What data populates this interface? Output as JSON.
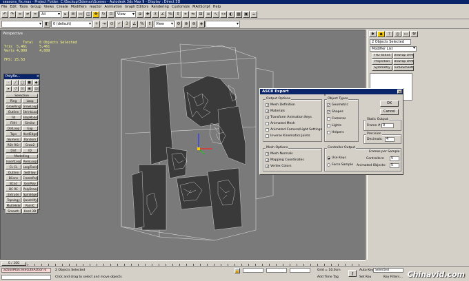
{
  "app": {
    "title": "seasons_fix.max - Project Folder: C:\\Backup\\3dsmax\\Scenes - Autodesk 3ds Max 9 - Display : Direct 3D"
  },
  "menu": [
    "File",
    "Edit",
    "Tools",
    "Group",
    "Views",
    "Create",
    "Modifiers",
    "reactor",
    "Animation",
    "Graph Editors",
    "Rendering",
    "Customize",
    "MAXScript",
    "Help"
  ],
  "toolbar": {
    "filter_select": "All",
    "view_select": "View",
    "layer_select": "0 (default)",
    "view_select_2": "View"
  },
  "viewport": {
    "label": "Perspective",
    "stats": "         Total   0 Objects Selected\nTris  5,461      5,461\nVerts 4,009      4,009",
    "fps": "FPS:  25.53"
  },
  "command_panel": {
    "object_field": "2 Objects Selected",
    "modifier_list": "Modifier List",
    "buttons": [
      "FFD 4x4x4",
      "Unwrap UVW",
      "Projection",
      "Unwrap UVW",
      "Symmetry",
      "TurboSmooth"
    ]
  },
  "polyboost": {
    "title": "PolyBo...",
    "selection_header": "Selection",
    "selection_buttons": [
      "Ring",
      "Loop",
      "GrowRing",
      "GrowLoop",
      "Outline",
      "ShrinkLoop",
      "Fill",
      "FillH",
      "StepMode",
      "Similar",
      "DotLoop",
      "Gap",
      "Tops",
      "HardEdges",
      "Numeric",
      "Random",
      "RSh",
      "RGr",
      "Grow2",
      "Dist",
      "ID"
    ],
    "modelling_header": "Modelling",
    "modelling_buttons": [
      "InsertLoop",
      "RemLoop",
      "CL",
      "CL",
      "LoopTools",
      "Outline",
      "SetFlow",
      "BConn",
      "CreatePoly",
      "BCnd",
      "GenPoly",
      "DC",
      "RC",
      "PolyDraw",
      "Extrude",
      "SpinEdge",
      "Topology",
      "QuadrilIfy",
      "MultiHide",
      "PaintC",
      "Smooth",
      "Hard",
      "3D"
    ]
  },
  "dialog": {
    "title": "ASCII Export",
    "output_options_label": "Output Options",
    "output_options": [
      {
        "label": "Mesh Definition",
        "checked": true
      },
      {
        "label": "Materials",
        "checked": true
      },
      {
        "label": "Transform Animation Keys",
        "checked": true
      },
      {
        "label": "Animated Mesh",
        "checked": false
      },
      {
        "label": "Animated Camera/Light Settings",
        "checked": false
      },
      {
        "label": "Inverse Kinematics Joints",
        "checked": false
      }
    ],
    "object_types_label": "Object Types",
    "object_types": [
      {
        "label": "Geometric",
        "checked": true
      },
      {
        "label": "Shapes",
        "checked": true
      },
      {
        "label": "Cameras",
        "checked": false
      },
      {
        "label": "Lights",
        "checked": false
      },
      {
        "label": "Helpers",
        "checked": false
      }
    ],
    "ok": "OK",
    "cancel": "Cancel",
    "static_output_label": "Static Output",
    "frame_label": "Frame #:",
    "frame_value": "0",
    "precision_label": "Precision",
    "decimals_label": "Decimals:",
    "decimals_value": "4",
    "mesh_options_label": "Mesh Options",
    "mesh_options": [
      {
        "label": "Mesh Normals",
        "checked": true
      },
      {
        "label": "Mapping Coordinates",
        "checked": true
      },
      {
        "label": "Vertex Colors",
        "checked": true
      }
    ],
    "controller_output_label": "Controller Output",
    "use_keys": "Use Keys",
    "force_sample": "Force Sample",
    "frames_per_sample_label": "Frames per Sample",
    "controllers_label": "Controllers:",
    "controllers_value": "5",
    "animated_objects_label": "Animated Objects:",
    "animated_objects_value": "5"
  },
  "timeslider": {
    "position": "0 / 100"
  },
  "status": {
    "script_field": "actionMan.executeAction 0",
    "selection": "2 Objects Selected",
    "prompt": "Click and drag to select and move objects",
    "grid": "Grid = 10.0cm",
    "add_time_tag": "Add Time Tag",
    "auto_key": "Auto Key",
    "set_key": "Set Key",
    "selected_dropdown": "Selected",
    "key_filters": "Key Filters..."
  },
  "watermark": "Chinavid.com"
}
